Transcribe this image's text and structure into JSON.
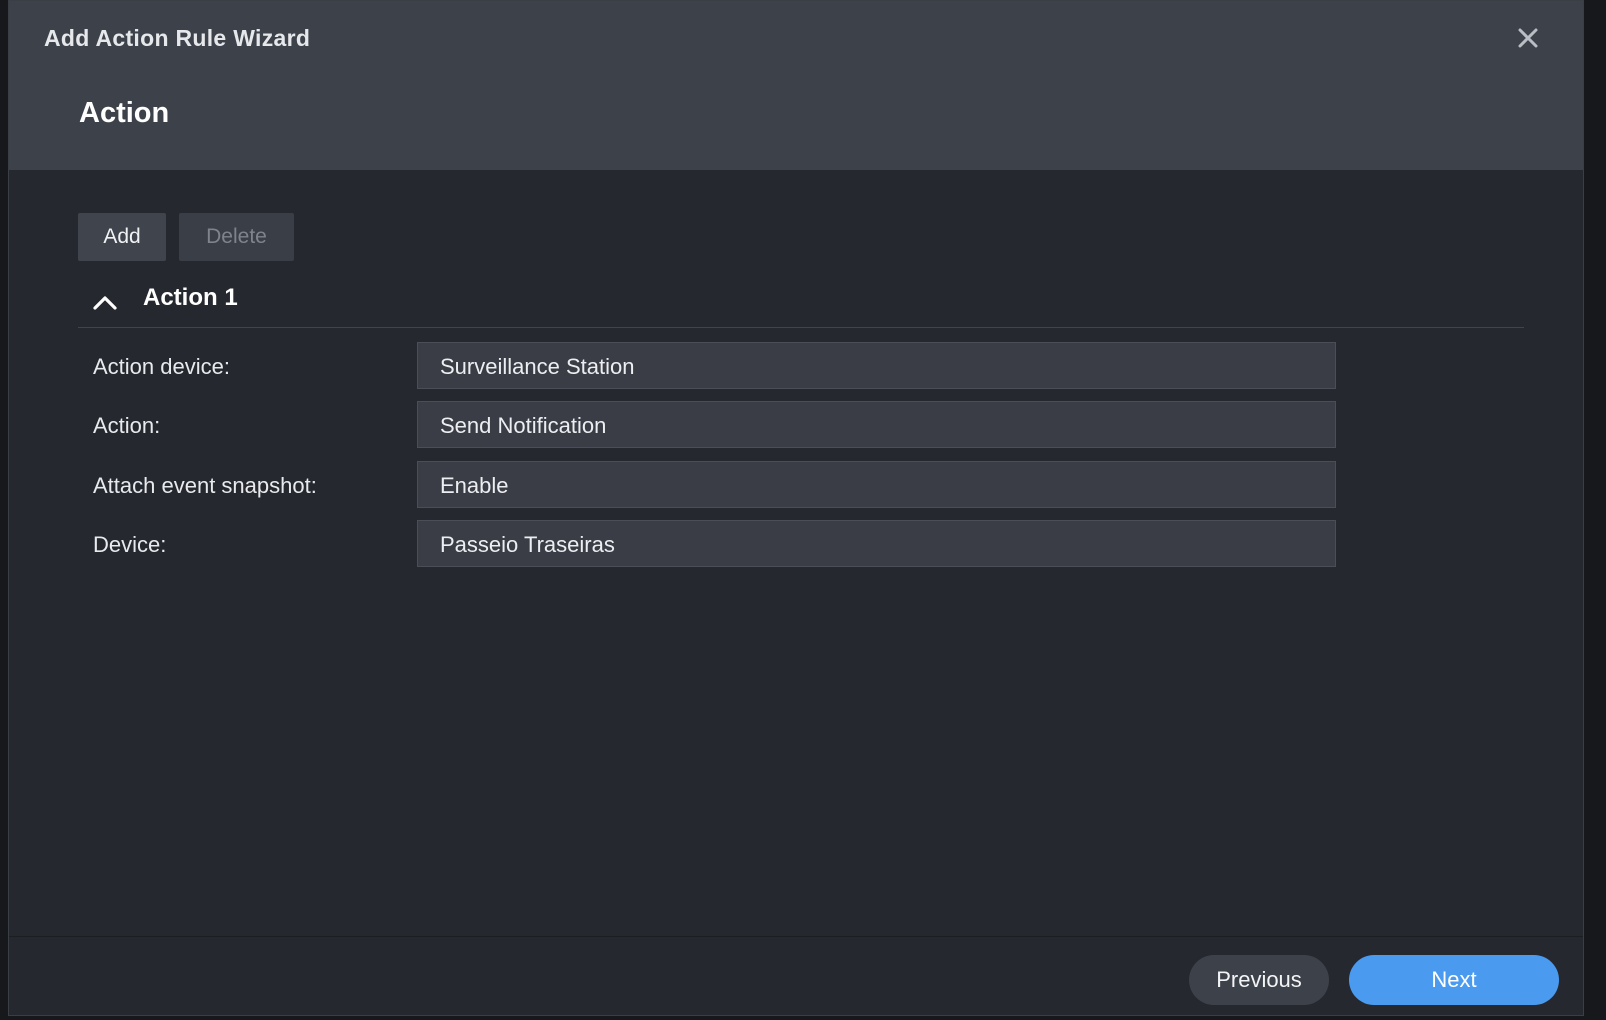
{
  "window": {
    "title": "Add Action Rule Wizard",
    "close_icon": "close-icon"
  },
  "step": {
    "title": "Action"
  },
  "toolbar": {
    "add_label": "Add",
    "delete_label": "Delete"
  },
  "section": {
    "title": "Action 1",
    "expanded": true,
    "icon": "chevron-up-icon"
  },
  "form": {
    "action_device": {
      "label": "Action device:",
      "value": "Surveillance Station"
    },
    "action": {
      "label": "Action:",
      "value": "Send Notification"
    },
    "attach_snapshot": {
      "label": "Attach event snapshot:",
      "value": "Enable"
    },
    "device": {
      "label": "Device:",
      "value": "Passeio Traseiras"
    }
  },
  "footer": {
    "previous_label": "Previous",
    "next_label": "Next"
  },
  "colors": {
    "accent": "#4a9bf0",
    "header_bg": "#3d414a",
    "body_bg": "#25282e"
  }
}
